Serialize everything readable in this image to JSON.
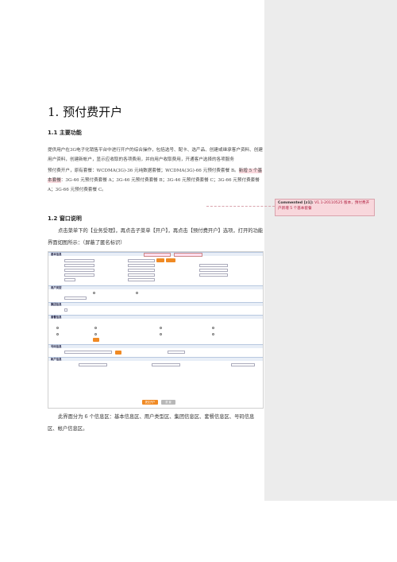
{
  "heading": "1.  预付费开户",
  "section_1_1": "1.1 主要功能",
  "main_function_text": "提供用户在3G电子化销售平台中进行开户的综合操作，包括选号、配卡、选产品、创建或继承客户资料、创建用户资料，创建新帐户，显示应收取的各项费用，并向用户收取费用，开通客户选择的各项服务",
  "package_line1": "预付费开户，原有套餐：WCDMA(3G)-36 元纯数据套餐；WCDMA(3G)-66 元预付费套餐 B。",
  "package_highlight": "新增 5 个基本套餐",
  "package_line2": "：3G-46 元预付费套餐 A；3G-46 元预付费套餐 B；3G-46 元预付费套餐 C；3G-66 元预付费套餐 A；3G-66 元预付费套餐 C。",
  "comment": {
    "label": "Commented [z1]:",
    "text": "V1.1-20110525 版本，预付费开户新增 5 个基本套餐"
  },
  "section_1_2": "1.2 窗口说明",
  "window_desc": "点击菜单下的【业务受理】，再点击子菜单【开户】，再点击【预付费开户】选项，打开的功能界面如图所示：（屏蔽了匿名标识）",
  "summary": "此界面分为 6 个信息区：基本信息区、用户类型区、集团信息区、套餐信息区、号码信息区、帐户信息区。",
  "screenshot": {
    "sections": [
      "基本信息",
      "用户类型",
      "集团信息",
      "套餐信息",
      "号码信息",
      "帐户信息"
    ],
    "submit_label": "提交开户",
    "reset_label": "重 置"
  }
}
